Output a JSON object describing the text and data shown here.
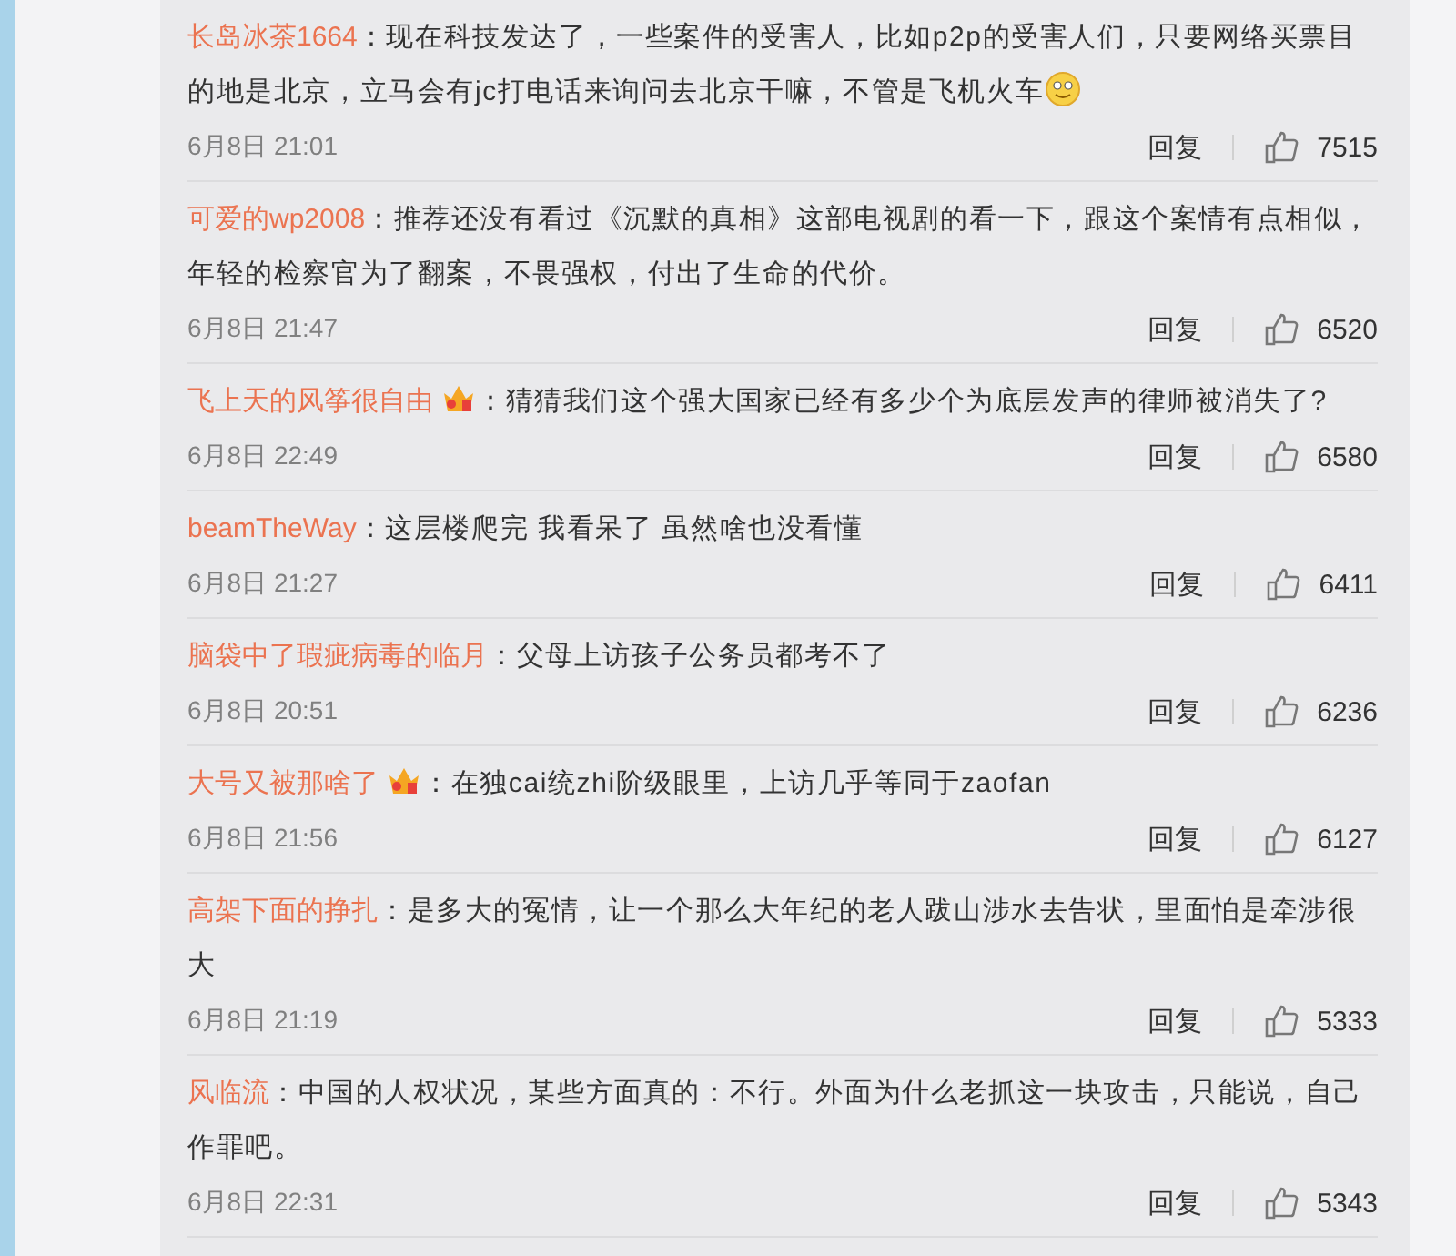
{
  "comments": [
    {
      "user": "长岛冰茶1664",
      "badge": false,
      "text": "：现在科技发达了，一些案件的受害人，比如p2p的受害人们，只要网络买票目的地是北京，立马会有jc打电话来询问去北京干嘛，不管是飞机火车",
      "emoji": true,
      "time": "6月8日 21:01",
      "reply": "回复",
      "likes": "7515"
    },
    {
      "user": "可爱的wp2008",
      "badge": false,
      "text": "：推荐还没有看过《沉默的真相》这部电视剧的看一下，跟这个案情有点相似，年轻的检察官为了翻案，不畏强权，付出了生命的代价。",
      "emoji": false,
      "time": "6月8日 21:47",
      "reply": "回复",
      "likes": "6520"
    },
    {
      "user": "飞上天的风筝很自由",
      "badge": true,
      "text": "：猜猜我们这个强大国家已经有多少个为底层发声的律师被消失了?",
      "emoji": false,
      "time": "6月8日 22:49",
      "reply": "回复",
      "likes": "6580"
    },
    {
      "user": "beamTheWay",
      "badge": false,
      "text": "：这层楼爬完 我看呆了 虽然啥也没看懂",
      "emoji": false,
      "time": "6月8日 21:27",
      "reply": "回复",
      "likes": "6411"
    },
    {
      "user": "脑袋中了瑕疵病毒的临月",
      "badge": false,
      "text": "：父母上访孩子公务员都考不了",
      "emoji": false,
      "time": "6月8日 20:51",
      "reply": "回复",
      "likes": "6236"
    },
    {
      "user": "大号又被那啥了",
      "badge": true,
      "text": "：在独cai统zhi阶级眼里，上访几乎等同于zaofan",
      "emoji": false,
      "time": "6月8日 21:56",
      "reply": "回复",
      "likes": "6127"
    },
    {
      "user": "高架下面的挣扎",
      "badge": false,
      "text": "：是多大的冤情，让一个那么大年纪的老人跋山涉水去告状，里面怕是牵涉很大",
      "emoji": false,
      "time": "6月8日 21:19",
      "reply": "回复",
      "likes": "5333"
    },
    {
      "user": "风临流",
      "badge": false,
      "text": "：中国的人权状况，某些方面真的：不行。外面为什么老抓这一块攻击，只能说，自己作罪吧。",
      "emoji": false,
      "time": "6月8日 22:31",
      "reply": "回复",
      "likes": "5343"
    }
  ]
}
